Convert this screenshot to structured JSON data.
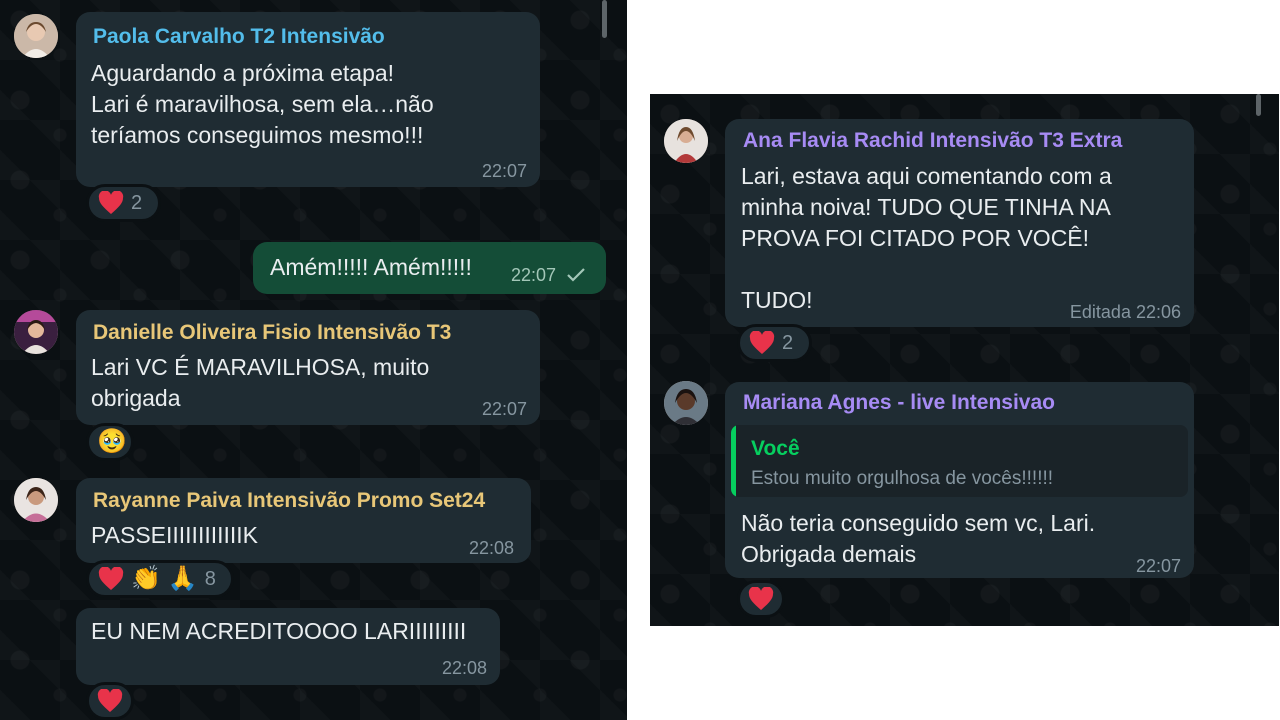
{
  "left_chat": {
    "messages": [
      {
        "sender": "Paola Carvalho T2 Intensivão",
        "sender_color": "#53bdeb",
        "text": "Aguardando a próxima etapa!\nLari é maravilhosa, sem ela…não\nteríamos conseguimos mesmo!!!",
        "time": "22:07",
        "reaction": {
          "emojis": [
            "heart-icon"
          ],
          "count": "2"
        }
      },
      {
        "text": "Amém!!!!! Amém!!!!!",
        "time": "22:07",
        "status": "check-icon"
      },
      {
        "sender": "Danielle Oliveira Fisio Intensivão T3",
        "sender_color": "#e8c778",
        "text": "Lari VC É MARAVILHOSA,  muito\nobrigada",
        "time": "22:07",
        "reaction": {
          "emojis": [
            "🥹"
          ]
        }
      },
      {
        "sender": "Rayanne Paiva Intensivão Promo Set24",
        "sender_color": "#e8c778",
        "text": "PASSEIIIIIIIIIIIIK",
        "time": "22:08",
        "reaction": {
          "emojis": [
            "heart-icon",
            "👏",
            "🙏"
          ],
          "count": "8"
        }
      },
      {
        "text": "EU NEM ACREDITOOOO LARIIIIIIIII",
        "time": "22:08",
        "reaction": {
          "emojis": [
            "heart-icon"
          ]
        }
      }
    ]
  },
  "right_chat": {
    "messages": [
      {
        "sender": "Ana Flavia Rachid Intensivão T3 Extra",
        "sender_color": "#a78bf4",
        "text": "Lari, estava aqui comentando com a\nminha noiva! TUDO QUE TINHA NA\nPROVA FOI CITADO POR VOCÊ!\n\nTUDO!",
        "time": "Editada 22:06",
        "reaction": {
          "emojis": [
            "heart-icon"
          ],
          "count": "2"
        }
      },
      {
        "sender": "Mariana Agnes - live Intensivao",
        "sender_color": "#a78bf4",
        "quote": {
          "sender": "Você",
          "text": "Estou muito orgulhosa de vocês!!!!!!"
        },
        "text": "Não teria conseguido sem vc, Lari.\nObrigada demais",
        "time": "22:07",
        "reaction": {
          "emojis": [
            "heart-icon"
          ]
        }
      }
    ]
  },
  "colors": {
    "background": "#0b1013",
    "incoming_bubble": "#1f2c33",
    "outgoing_bubble": "#144d37",
    "heart": "#e8334a"
  }
}
